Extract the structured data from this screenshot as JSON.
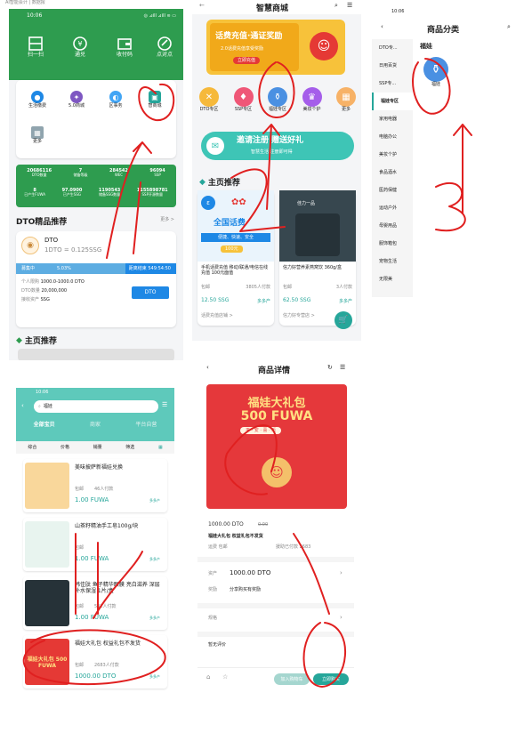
{
  "page_header": "AI智能会计 | 数据报",
  "s1": {
    "status": {
      "time": "10:06",
      "icons": "◎ ⊿ill ⊿ill ≋ ▭"
    },
    "quick": [
      {
        "label": "扫一扫"
      },
      {
        "label": "通兑"
      },
      {
        "label": "收付码"
      },
      {
        "label": "点对点"
      }
    ],
    "services": [
      {
        "label": "生活缴费"
      },
      {
        "label": "5.0商城"
      },
      {
        "label": "区事务"
      },
      {
        "label": "智商城"
      }
    ],
    "more_label": "更多",
    "stats_row1": [
      {
        "value": "20686116",
        "label": "DTO数量"
      },
      {
        "value": "7",
        "label": "储备等级"
      },
      {
        "value": "284542",
        "label": "WEC"
      },
      {
        "value": "96094",
        "label": "SSP"
      }
    ],
    "stats_row2": [
      {
        "value": "8",
        "label": "已产生FUWA"
      },
      {
        "value": "97.0900",
        "label": "已产生SSG"
      },
      {
        "value": "1190543",
        "label": "储备SSG数量"
      },
      {
        "value": "1155898781",
        "label": "SSP开源数量"
      }
    ],
    "dto_section": {
      "title": "DTO精品推荐",
      "more": "更多 >"
    },
    "dto_card": {
      "name": "DTO",
      "rate": "1DTO = 0.125SSG",
      "status": "募集中",
      "percent": "5.03%",
      "countdown": "距离结束  549:54:50",
      "row1_label": "个人限购",
      "row1_value": "1000.0-1000.0 DTO",
      "row2_label": "DTO数量",
      "row2_value": "20,000,000",
      "row3_label": "接收资产",
      "row3_value": "SSG",
      "button": "DTO"
    },
    "main_recommend": "主页推荐"
  },
  "s2": {
    "title": "智慧商城",
    "banner": {
      "title": "话费充值·通证奖励",
      "sub": "2.0话费充值享受奖励",
      "btn": "立即充值"
    },
    "categories": [
      {
        "label": "DTO专区"
      },
      {
        "label": "SSP专区"
      },
      {
        "label": "福娃专区"
      },
      {
        "label": "美妆个护"
      },
      {
        "label": "更多"
      }
    ],
    "invite": {
      "title": "邀请注册 赠送好礼",
      "sub": "智慧生活 注册即可得"
    },
    "section": "主页推荐",
    "products": [
      {
        "img_title": "全国话费",
        "img_sub": "便捷、快速、安全",
        "img_badge": "100元",
        "name": "手机话费充值 移动/联通/电信在线充值 100元面值",
        "ship": "包邮",
        "sold": "3805人付款",
        "price": "12.50 SSG",
        "tag": "多多产",
        "store": "话费充值店铺 >"
      },
      {
        "img_title": "佳力一品",
        "name": "信力好营养素燕窝饮 360g/盒",
        "ship": "包邮",
        "sold": "3人付款",
        "price": "62.50 SSG",
        "tag": "多多产",
        "store": "信力好专营店 >"
      }
    ]
  },
  "s3": {
    "status": {
      "time": "10:06"
    },
    "title": "商品分类",
    "sidebar": [
      {
        "label": "DTO专..."
      },
      {
        "label": "日用百货"
      },
      {
        "label": "SSP专..."
      },
      {
        "label": "福娃专区"
      },
      {
        "label": "家用电器"
      },
      {
        "label": "电脑办公"
      },
      {
        "label": "美妆个护"
      },
      {
        "label": "食品酒水"
      },
      {
        "label": "医药保健"
      },
      {
        "label": "运动户外"
      },
      {
        "label": "母婴用品"
      },
      {
        "label": "服饰箱包"
      },
      {
        "label": "宠物生活"
      },
      {
        "label": "无限美"
      }
    ],
    "active_index": 3,
    "content_title": "福娃",
    "item_label": "福娃"
  },
  "s4": {
    "status": {
      "time": "10:06"
    },
    "search": "福娃",
    "tabs": [
      {
        "label": "全部宝贝"
      },
      {
        "label": "商家"
      },
      {
        "label": "平台自营"
      }
    ],
    "filters": [
      {
        "label": "综合"
      },
      {
        "label": "价格"
      },
      {
        "label": "销量"
      },
      {
        "label": "筛选"
      }
    ],
    "products": [
      {
        "name": "美味披萨新福娃兑换",
        "ship": "包邮",
        "sold": "46人付款",
        "price": "1.00 FUWA",
        "tag": "多多产"
      },
      {
        "name": "山茶籽精油手工皂100g/块",
        "ship": "包邮",
        "sold": "",
        "price": "1.00 FUWA",
        "tag": "多多产"
      },
      {
        "name": "韩佳肽 鱼子精华眼膜 亮白滋养 深层补水保湿 1片/盒",
        "ship": "包邮",
        "sold": "532人付款",
        "price": "1.00 FUWA",
        "tag": "多多产"
      },
      {
        "name": "福娃大礼包 权益礼包不发货",
        "ship": "包邮",
        "sold": "2683人付款",
        "price": "1000.00 DTO",
        "tag": "多多产",
        "img_text": "福娃大礼包 500 FUWA"
      }
    ]
  },
  "s5": {
    "title": "商品详情",
    "banner": {
      "line1": "福娃大礼包",
      "line2": "500 FUWA",
      "ribbon": "平 · 安 · 喜 · 乐"
    },
    "price": "1000.00 DTO",
    "old_price": "0.00",
    "name": "福娃大礼包 权益礼包不发货",
    "ship": "运费 包邮",
    "sold": "援助已付款 2683",
    "asset_label": "资产",
    "asset_value": "1000.00 DTO",
    "reward_label": "奖励",
    "reward_value": "分享购买有奖励",
    "spec_label": "规格",
    "reviews": "暂无评价",
    "btn_cart": "加入购物车",
    "btn_buy": "立即购买"
  }
}
